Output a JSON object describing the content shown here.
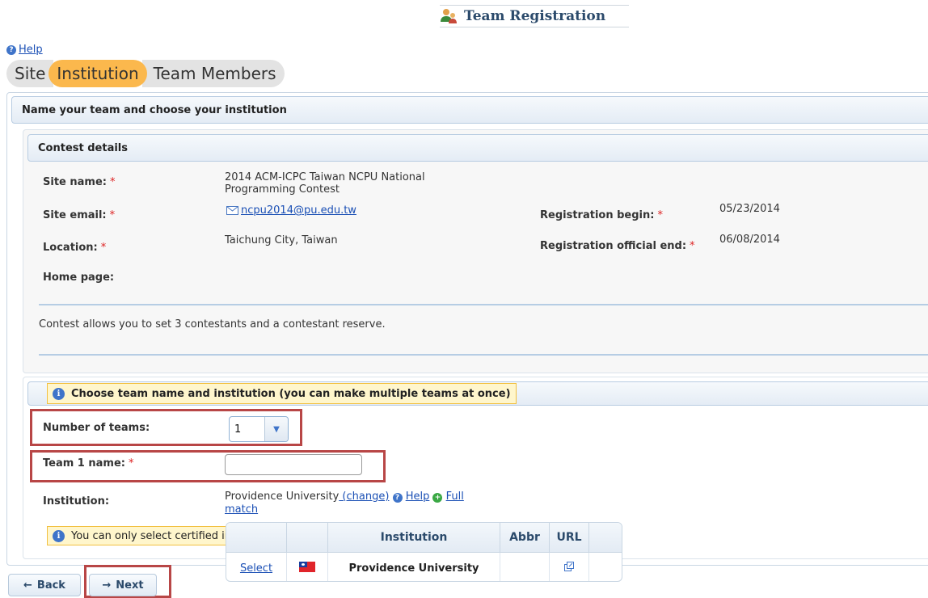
{
  "page": {
    "title": "Team Registration",
    "help": "Help"
  },
  "tabs": [
    {
      "label": "Site"
    },
    {
      "label": "Institution"
    },
    {
      "label": "Team Members"
    }
  ],
  "outer_header": "Name your team and choose your institution",
  "contest": {
    "header": "Contest details",
    "site_name_label": "Site name:",
    "site_name_value_line1": "2014 ACM-ICPC Taiwan NCPU National",
    "site_name_value_line2": "Programming Contest",
    "site_email_label": "Site email:",
    "site_email_value": "ncpu2014@pu.edu.tw",
    "location_label": "Location:",
    "location_value": "Taichung City, Taiwan",
    "home_page_label": "Home page:",
    "reg_begin_label": "Registration begin:",
    "reg_begin_value": "05/23/2014",
    "reg_end_label": "Registration official end:",
    "reg_end_value": "06/08/2014",
    "required_mark": "*",
    "note": "Contest allows you to set 3 contestants and a contestant reserve."
  },
  "choose": {
    "notice": "Choose team name and institution (you can make multiple teams at once)",
    "num_teams_label": "Number of teams:",
    "num_teams_value": "1",
    "team_name_label": "Team 1 name:",
    "team_name_value": "",
    "institution_label": "Institution:",
    "institution_value": "Providence University",
    "change_link": " (change)",
    "help_link": "Help",
    "full_match_line1": "Full",
    "full_match_line2": "match",
    "bottom_notice": "You can only select certified institutions"
  },
  "institution_table": {
    "columns": [
      "",
      "",
      "Institution",
      "Abbr",
      "URL",
      ""
    ],
    "rows": [
      {
        "select": "Select",
        "institution": "Providence University",
        "abbr": ""
      }
    ]
  },
  "buttons": {
    "back": "Back",
    "next": "Next"
  },
  "icons": {
    "title": "team-users-icon",
    "help": "question-circle-icon",
    "info": "info-circle-icon",
    "email": "envelope-icon",
    "add": "plus-circle-icon",
    "flag": "taiwan-flag-icon",
    "external": "external-link-icon"
  }
}
